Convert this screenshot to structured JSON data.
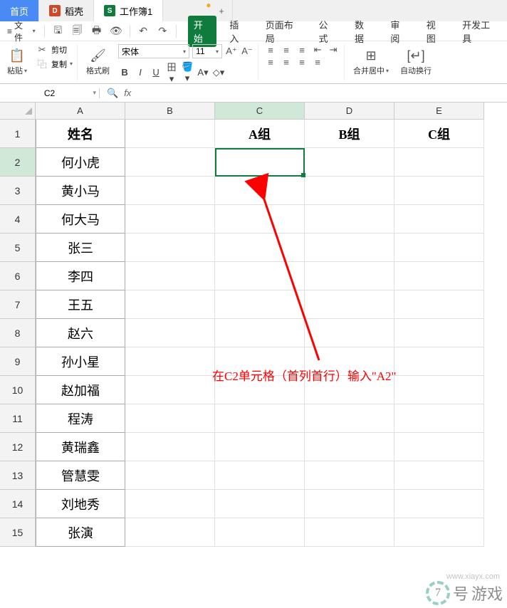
{
  "tabs": {
    "home": "首页",
    "doc1": "稻壳",
    "doc1_icon": "D",
    "doc2": "工作簿1",
    "doc2_icon": "S",
    "modified": "●",
    "plus": "+"
  },
  "menu": {
    "file": "文件",
    "undo": "↶",
    "redo": "↷"
  },
  "ribbon_tabs": {
    "start": "开始",
    "insert": "插入",
    "pagelayout": "页面布局",
    "formula": "公式",
    "data": "数据",
    "review": "审阅",
    "view": "视图",
    "dev": "开发工具"
  },
  "ribbon": {
    "paste": "粘贴",
    "cut": "剪切",
    "copy": "复制",
    "formatpainter": "格式刷",
    "font": "宋体",
    "fontsize": "11",
    "merge": "合并居中",
    "wrap": "自动换行"
  },
  "formula_bar": {
    "cell_ref": "C2",
    "fx": "fx"
  },
  "columns": [
    "A",
    "B",
    "C",
    "D",
    "E"
  ],
  "rows": [
    "1",
    "2",
    "3",
    "4",
    "5",
    "6",
    "7",
    "8",
    "9",
    "10",
    "11",
    "12",
    "13",
    "14",
    "15"
  ],
  "data": {
    "A1": "姓名",
    "C1": "A组",
    "D1": "B组",
    "E1": "C组",
    "A2": "何小虎",
    "A3": "黄小马",
    "A4": "何大马",
    "A5": "张三",
    "A6": "李四",
    "A7": "王五",
    "A8": "赵六",
    "A9": "孙小星",
    "A10": "赵加福",
    "A11": "程涛",
    "A12": "黄瑞鑫",
    "A13": "管慧雯",
    "A14": "刘地秀",
    "A15": "张演"
  },
  "annotation": {
    "text": "在C2单元格（首列首行）输入\"A2\""
  },
  "watermark": {
    "num": "7",
    "label": "号",
    "brand": "游戏",
    "url": "www.xiayx.com"
  },
  "selected_cell": "C2"
}
